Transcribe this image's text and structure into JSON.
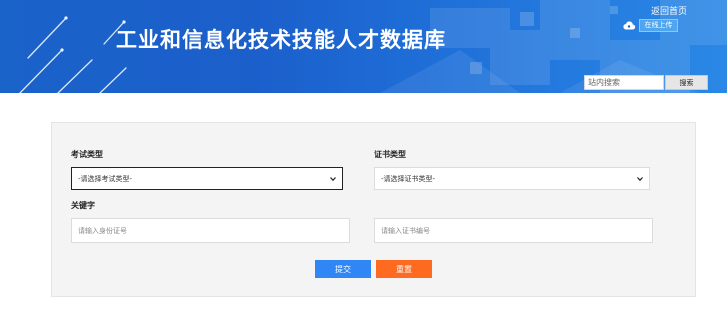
{
  "header": {
    "title": "工业和信息化技术技能人才数据库",
    "home_link": "返回首页",
    "upload_label": "在线上传",
    "search_placeholder": "站内搜索",
    "search_button": "搜索"
  },
  "form": {
    "exam_type": {
      "label": "考试类型",
      "selected": "-请选择考试类型-"
    },
    "cert_type": {
      "label": "证书类型",
      "selected": "-请选择证书类型-"
    },
    "keyword": {
      "label": "关键字",
      "id_placeholder": "请输入身份证号",
      "cert_no_placeholder": "请输入证书编号"
    },
    "submit_label": "提交",
    "reset_label": "重置"
  },
  "colors": {
    "banner": "#1b5fcb",
    "submit": "#2f86f4",
    "reset": "#ff6a21"
  }
}
